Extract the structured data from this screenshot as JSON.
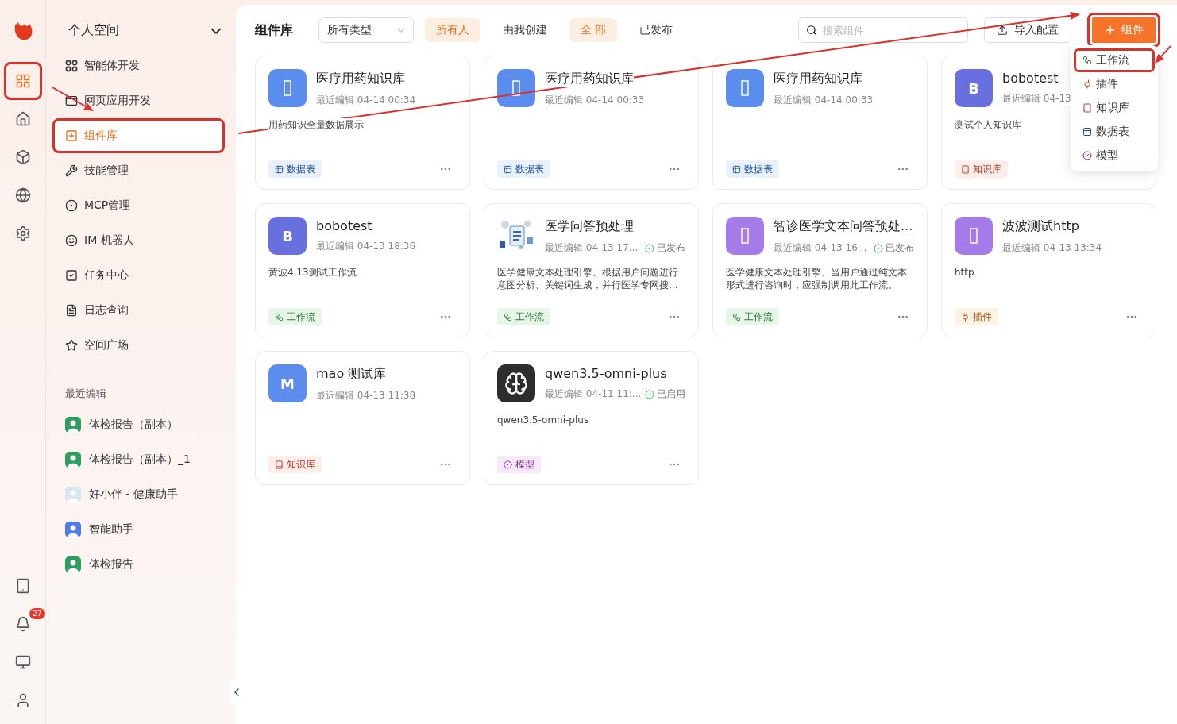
{
  "rail": {
    "items": [
      {
        "kind": "grid",
        "selected": true,
        "annotated": true
      },
      {
        "kind": "home",
        "selected": false,
        "annotated": false
      },
      {
        "kind": "cube",
        "selected": false,
        "annotated": false
      },
      {
        "kind": "globe",
        "selected": false,
        "annotated": false
      },
      {
        "kind": "settings",
        "selected": false,
        "annotated": false
      }
    ],
    "bottom_items": [
      {
        "kind": "tablet"
      },
      {
        "kind": "bell",
        "badge": "27"
      },
      {
        "kind": "monitor"
      },
      {
        "kind": "user"
      }
    ]
  },
  "sidebar": {
    "workspace": "个人空间",
    "items": [
      {
        "kind": "agents",
        "label": "智能体开发",
        "selected": false,
        "annotated": false
      },
      {
        "kind": "webapp",
        "label": "网页应用开发",
        "selected": false,
        "annotated": false
      },
      {
        "kind": "components",
        "label": "组件库",
        "selected": true,
        "annotated": true
      },
      {
        "kind": "skills",
        "label": "技能管理",
        "selected": false,
        "annotated": false
      },
      {
        "kind": "mcp",
        "label": "MCP管理",
        "selected": false,
        "annotated": false
      },
      {
        "kind": "bot",
        "label": "IM 机器人",
        "selected": false,
        "annotated": false
      },
      {
        "kind": "tasks",
        "label": "任务中心",
        "selected": false,
        "annotated": false
      },
      {
        "kind": "logs",
        "label": "日志查询",
        "selected": false,
        "annotated": false
      },
      {
        "kind": "plaza",
        "label": "空间广场",
        "selected": false,
        "annotated": false
      }
    ],
    "recent_title": "最近编辑",
    "recent": [
      {
        "label": "体检报告（副本）",
        "color": "#2e9e5e"
      },
      {
        "label": "体检报告（副本）_1",
        "color": "#2e9e5e"
      },
      {
        "label": "好小伴 - 健康助手",
        "color": "#d9e6f0"
      },
      {
        "label": "智能助手",
        "color": "#4f7be8"
      },
      {
        "label": "体检报告",
        "color": "#2e9e5e"
      }
    ]
  },
  "toolbar": {
    "title": "组件库",
    "type_select": "所有类型",
    "owner_filters": [
      {
        "label": "所有人",
        "selected": true
      },
      {
        "label": "由我创建",
        "selected": false
      }
    ],
    "status_filters": [
      {
        "label": "全 部",
        "selected": true
      },
      {
        "label": "已发布",
        "selected": false
      }
    ],
    "search": {
      "placeholder": "搜索组件"
    },
    "import_button": "导入配置",
    "add_button": {
      "label": "组件",
      "annotated": true
    }
  },
  "add_menu": [
    {
      "kind": "workflow",
      "label": "工作流",
      "annotated": true
    },
    {
      "kind": "plugin",
      "label": "插件",
      "annotated": false
    },
    {
      "kind": "knowledge",
      "label": "知识库",
      "annotated": false
    },
    {
      "kind": "datatable",
      "label": "数据表",
      "annotated": false
    },
    {
      "kind": "model",
      "label": "模型",
      "annotated": false
    }
  ],
  "cards": [
    {
      "avatar": {
        "kind": "glyph",
        "color": "#5b8def"
      },
      "title": "医疗用药知识库",
      "edited": "最近编辑 04-14 00:34",
      "description": "用药知识全量数据展示",
      "tag": {
        "kind": "datatable",
        "label": "数据表"
      }
    },
    {
      "avatar": {
        "kind": "glyph",
        "color": "#5b8def"
      },
      "title": "医疗用药知识库",
      "edited": "最近编辑 04-14 00:33",
      "tag": {
        "kind": "datatable",
        "label": "数据表"
      }
    },
    {
      "avatar": {
        "kind": "glyph",
        "color": "#5b8def"
      },
      "title": "医疗用药知识库",
      "edited": "最近编辑 04-14 00:33",
      "tag": {
        "kind": "datatable",
        "label": "数据表"
      }
    },
    {
      "avatar": {
        "kind": "letter",
        "letter": "B",
        "color": "#6a6fe0"
      },
      "title": "bobotest",
      "edited": "最近编辑 04-13",
      "description": "测试个人知识库",
      "tag": {
        "kind": "knowledge",
        "label": "知识库"
      }
    },
    {
      "avatar": {
        "kind": "letter",
        "letter": "B",
        "color": "#6a6fe0"
      },
      "title": "bobotest",
      "edited": "最近编辑 04-13 18:36",
      "description": "黄波4.13测试工作流",
      "tag": {
        "kind": "workflow",
        "label": "工作流"
      }
    },
    {
      "title": "医学问答预处理",
      "edited": "最近编辑 04-13 17...",
      "status": "已发布",
      "description": "医学健康文本处理引擎。根据用户问题进行意图分析、关键词生成，并行医学专网搜...",
      "tag": {
        "kind": "workflow",
        "label": "工作流"
      }
    },
    {
      "avatar": {
        "kind": "glyph",
        "color": "#a47be8"
      },
      "title": "智诊医学文本问答预处...",
      "edited": "最近编辑 04-13 16...",
      "status": "已发布",
      "description": "医学健康文本处理引擎。当用户通过纯文本形式进行咨询时，应强制调用此工作流。",
      "tag": {
        "kind": "workflow",
        "label": "工作流"
      }
    },
    {
      "avatar": {
        "kind": "glyph",
        "color": "#a47be8"
      },
      "title": "波波测试http",
      "edited": "最近编辑 04-13 13:34",
      "description": "http",
      "tag": {
        "kind": "plugin",
        "label": "插件"
      }
    },
    {
      "avatar": {
        "kind": "letter",
        "letter": "M",
        "color": "#5b8def"
      },
      "title": "mao 测试库",
      "edited": "最近编辑 04-13 11:38",
      "tag": {
        "kind": "knowledge",
        "label": "知识库"
      }
    },
    {
      "avatar": {
        "kind": "model"
      },
      "title": "qwen3.5-omni-plus",
      "edited": "最近编辑 04-11 11:...",
      "status": "已启用",
      "description": "qwen3.5-omni-plus",
      "tag": {
        "kind": "model",
        "label": "模型"
      }
    }
  ],
  "annotation_arrows": [
    {
      "kind": "arrow"
    },
    {
      "kind": "arrow"
    },
    {
      "kind": "arrow"
    }
  ]
}
